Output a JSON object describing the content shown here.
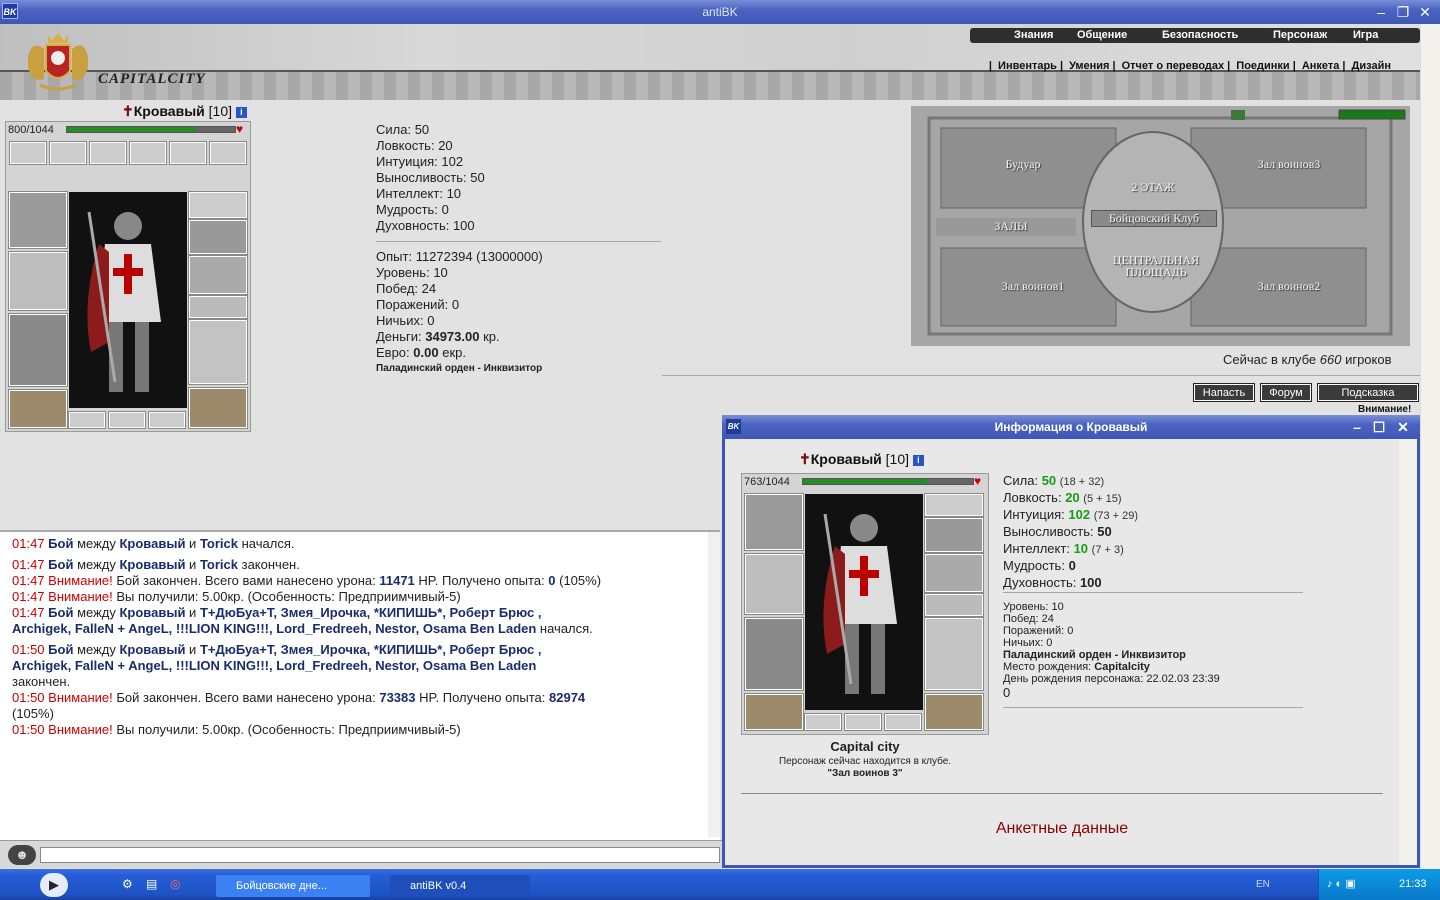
{
  "window": {
    "title": "antiBK",
    "app_icon": "BK"
  },
  "header": {
    "brand": "CAPITALCITY",
    "topnav": [
      "Знания",
      "Общение",
      "Безопасность",
      "Персонаж",
      "Игра"
    ],
    "subnav": [
      "Инвентарь",
      "Умения",
      "Отчет о переводах",
      "Поединки",
      "Анкета",
      "Дизайн"
    ]
  },
  "character": {
    "name": "Кровавый",
    "level": "[10]",
    "hp": "800/1044",
    "hp_fraction": 0.77,
    "stats": [
      {
        "label": "Сила:",
        "value": "50"
      },
      {
        "label": "Ловкость:",
        "value": "20"
      },
      {
        "label": "Интуиция:",
        "value": "102"
      },
      {
        "label": "Выносливость:",
        "value": "50"
      },
      {
        "label": "Интеллект:",
        "value": "10"
      },
      {
        "label": "Мудрость:",
        "value": "0"
      },
      {
        "label": "Духовность:",
        "value": "100"
      }
    ],
    "exp_label": "Опыт:",
    "exp": "11272394 (13000000)",
    "level_label": "Уровень:",
    "level_value": "10",
    "wins_label": "Побед:",
    "wins": "24",
    "losses_label": "Поражений:",
    "losses": "0",
    "draws_label": "Ничьих:",
    "draws": "0",
    "money_label": "Деньги:",
    "money": "34973.00",
    "money_unit": "кр.",
    "euro_label": "Евро:",
    "euro": "0.00",
    "euro_unit": "екр.",
    "order": "Паладинский орден - Инквизитор"
  },
  "map": {
    "rooms": [
      "Будуар",
      "Зал воинов3",
      "2 ЭТАЖ",
      "Бойцовский Клуб",
      "ЗАЛЫ",
      "ЦЕНТРАЛЬНАЯ ПЛОЩАДЬ",
      "Зал воинов1",
      "Зал воинов2"
    ]
  },
  "online": {
    "prefix": "Сейчас в клубе",
    "count": "660",
    "suffix": "игроков"
  },
  "actions": [
    "Напасть",
    "Форум",
    "Подсказка"
  ],
  "warning_cut": "Внимание!",
  "chat": [
    {
      "time": "01:47",
      "parts": [
        {
          "t": "Бой",
          "b": 1
        },
        {
          "t": " между "
        },
        {
          "t": "Кровавый",
          "b": 1
        },
        {
          "t": " и "
        },
        {
          "t": "Torick",
          "b": 1
        },
        {
          "t": " начался."
        }
      ]
    },
    {
      "time": "01:47",
      "parts": [
        {
          "t": "Бой",
          "b": 1
        },
        {
          "t": " между "
        },
        {
          "t": "Кровавый",
          "b": 1
        },
        {
          "t": "  и "
        },
        {
          "t": "Torick",
          "b": 1
        },
        {
          "t": " закончен."
        }
      ]
    },
    {
      "time": "01:47",
      "parts": [
        {
          "t": "Внимание!",
          "w": 1
        },
        {
          "t": " Бой закончен. Всего вами нанесено урона: "
        },
        {
          "t": "11471",
          "b": 1
        },
        {
          "t": " HP. Получено опыта: "
        },
        {
          "t": "0",
          "b": 1
        },
        {
          "t": " (105%)"
        }
      ]
    },
    {
      "time": "01:47",
      "parts": [
        {
          "t": "Внимание!",
          "w": 1
        },
        {
          "t": " Вы получили: 5.00кр. (Особенность: Предприимчивый-5)"
        }
      ]
    },
    {
      "time": "01:47",
      "parts": [
        {
          "t": "Бой",
          "b": 1
        },
        {
          "t": " между "
        },
        {
          "t": "Кровавый",
          "b": 1
        },
        {
          "t": " и "
        },
        {
          "t": "T+ДюБуа+T, Змея_Ирочка, *КИПИШЬ*, Роберт Брюс ,",
          "b": 1
        }
      ]
    },
    {
      "time": "",
      "parts": [
        {
          "t": "Archigek, FalleN + AngeL, !!!LION KING!!!, Lord_Fredreeh, Nestor, Osama Ben Laden",
          "b": 1
        },
        {
          "t": " начался."
        }
      ]
    },
    {
      "time": "01:50",
      "parts": [
        {
          "t": "Бой",
          "b": 1
        },
        {
          "t": " между "
        },
        {
          "t": "Кровавый",
          "b": 1
        },
        {
          "t": "  и "
        },
        {
          "t": "T+ДюБуа+T, Змея_Ирочка, *КИПИШЬ*, Роберт Брюс ,",
          "b": 1
        }
      ]
    },
    {
      "time": "",
      "parts": [
        {
          "t": "Archigek, FalleN + AngeL, !!!LION KING!!!, Lord_Fredreeh, Nestor, Osama Ben Laden",
          "b": 1
        }
      ]
    },
    {
      "time": "",
      "parts": [
        {
          "t": "закончен."
        }
      ]
    },
    {
      "time": "01:50",
      "parts": [
        {
          "t": "Внимание!",
          "w": 1
        },
        {
          "t": " Бой закончен. Всего вами нанесено урона: "
        },
        {
          "t": "73383",
          "b": 1
        },
        {
          "t": " HP. Получено опыта: "
        },
        {
          "t": "82974",
          "b": 1
        }
      ]
    },
    {
      "time": "",
      "parts": [
        {
          "t": "(105%)"
        }
      ]
    },
    {
      "time": "01:50",
      "parts": [
        {
          "t": "Внимание!",
          "w": 1
        },
        {
          "t": " Вы получили: 5.00кр. (Особенность: Предприимчивый-5)"
        }
      ]
    }
  ],
  "popup": {
    "title": "Информация о Кровавый",
    "name": "Кровавый",
    "level": "[10]",
    "hp": "763/1044",
    "hp_fraction": 0.73,
    "stats": [
      {
        "label": "Сила:",
        "value": "50",
        "extra": "(18 + 32)",
        "green": true
      },
      {
        "label": "Ловкость:",
        "value": "20",
        "extra": "(5 + 15)",
        "green": true
      },
      {
        "label": "Интуиция:",
        "value": "102",
        "extra": "(73 + 29)",
        "green": true
      },
      {
        "label": "Выносливость:",
        "value": "50",
        "extra": "",
        "green": false
      },
      {
        "label": "Интеллект:",
        "value": "10",
        "extra": "(7 + 3)",
        "green": true
      },
      {
        "label": "Мудрость:",
        "value": "0",
        "extra": "",
        "green": false
      },
      {
        "label": "Духовность:",
        "value": "100",
        "extra": "",
        "green": false
      }
    ],
    "info": [
      "Уровень: 10",
      "Побед: 24",
      "Поражений: 0",
      "Ничьих: 0"
    ],
    "order": "Паладинский орден - Инквизитор",
    "birthplace_label": "Место рождения:",
    "birthplace": "Capitalcity",
    "birthday": "День рождения персонажа: 22.02.03 23:39",
    "zero": "0",
    "city": "Capital city",
    "location_text": "Персонаж сейчас находится в клубе.",
    "location_room": "\"Зал воинов 3\"",
    "anketa": "Анкетные данные"
  },
  "taskbar": {
    "tasks": [
      "Бойцовские дне...",
      "antiBK v0.4"
    ],
    "lang": "EN",
    "clock": "21:33"
  },
  "colors": {
    "accent": "#3e56b6",
    "danger": "#cc0000",
    "hp": "#2a8a2a",
    "link": "#1a2c6e"
  }
}
